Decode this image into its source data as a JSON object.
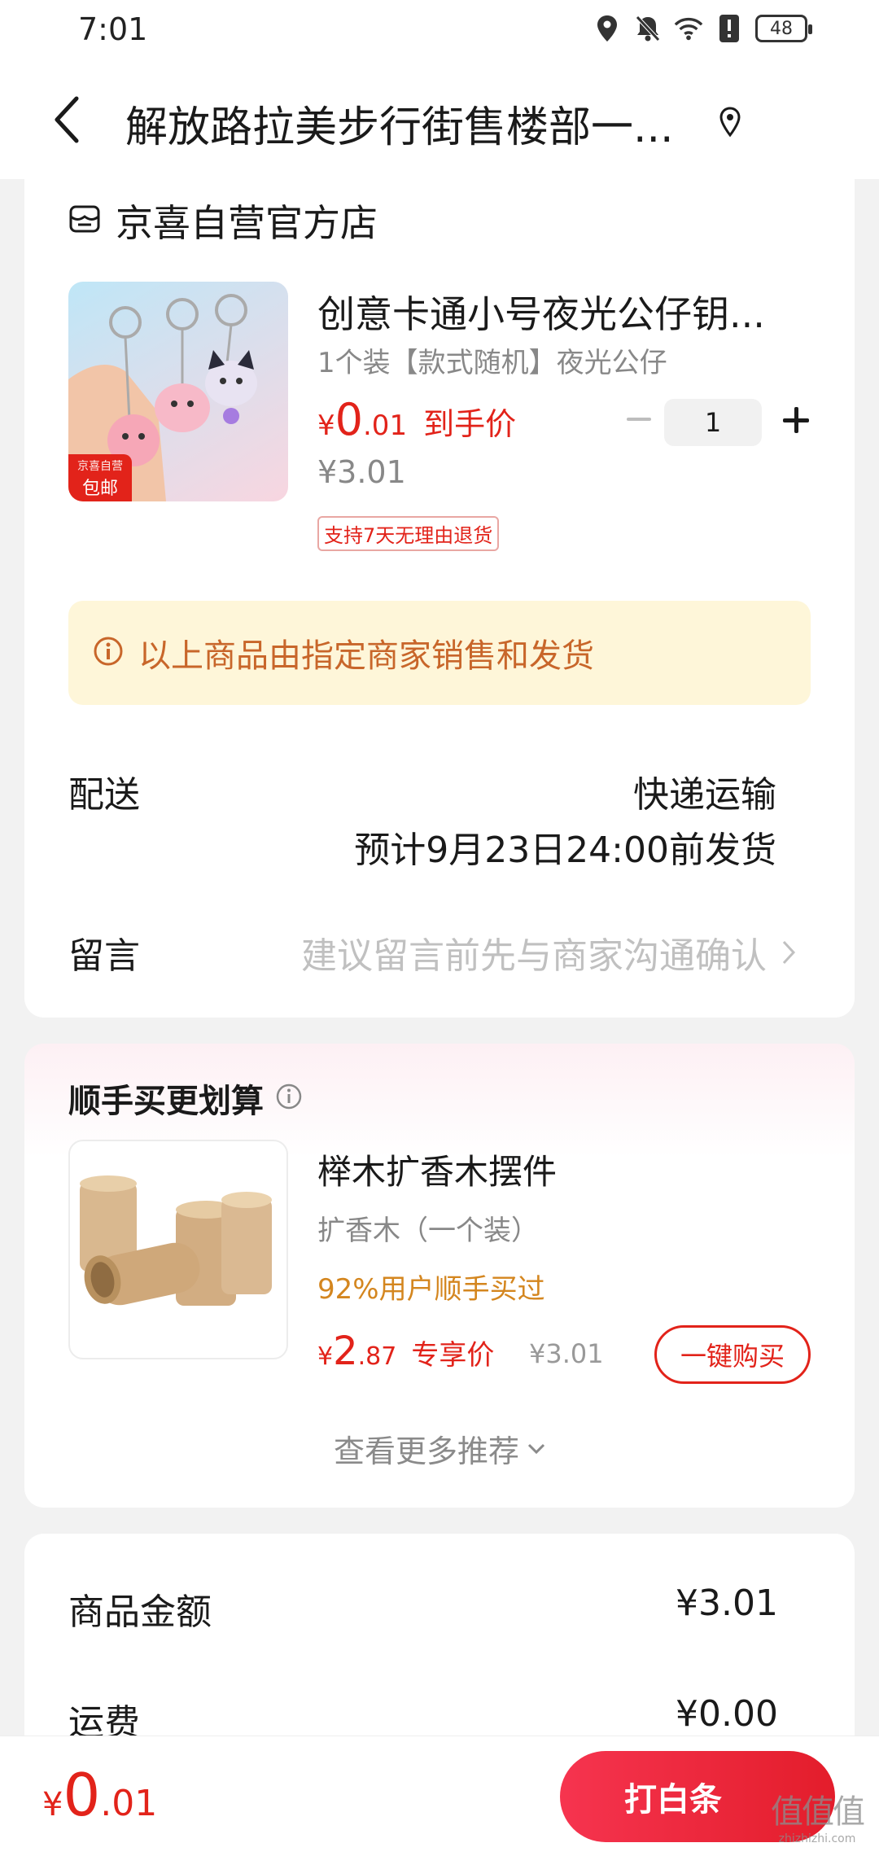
{
  "status": {
    "time": "7:01",
    "battery": "48"
  },
  "header": {
    "title": "解放路拉美步行街售楼部一..."
  },
  "store": {
    "name": "京喜自营官方店"
  },
  "product": {
    "title": "创意卡通小号夜光公仔钥...",
    "spec": "1个装【款式随机】夜光公仔",
    "price_symbol": "¥",
    "price_int": "0",
    "price_dec": ".01",
    "price_note": "到手价",
    "original_price": "¥3.01",
    "badge_line1": "京喜自营",
    "badge_line2": "包邮",
    "return_tag": "支持7天无理由退货",
    "quantity": "1"
  },
  "notice": {
    "text": "以上商品由指定商家销售和发货"
  },
  "delivery": {
    "label": "配送",
    "method": "快递运输",
    "eta": "预计9月23日24:00前发货"
  },
  "message": {
    "label": "留言",
    "placeholder": "建议留言前先与商家沟通确认"
  },
  "recommend": {
    "title": "顺手买更划算",
    "item": {
      "name": "榉木扩香木摆件",
      "spec": "扩香木（一个装）",
      "stat": "92%用户顺手买过",
      "price_symbol": "¥",
      "price_int": "2",
      "price_dec": ".87",
      "price_note": "专享价",
      "original_price": "¥3.01",
      "buy_label": "一键购买"
    },
    "more_label": "查看更多推荐"
  },
  "summary": {
    "goods_label": "商品金额",
    "goods_value": "¥3.01",
    "shipping_label": "运费",
    "shipping_value": "¥0.00"
  },
  "footer": {
    "total_symbol": "¥",
    "total_int": "0",
    "total_dec": ".01",
    "pay_label": "打白条",
    "watermark": "值值值",
    "watermark_sub": "zhizhizhi.com"
  },
  "colors": {
    "accent_red": "#e2231a",
    "notice_bg": "#fef6d9",
    "notice_text": "#c8662a",
    "stat_orange": "#d4861f"
  },
  "icons": [
    "location-icon",
    "mute-icon",
    "wifi-icon",
    "alert-icon",
    "battery-icon",
    "back-icon",
    "pin-icon",
    "store-icon",
    "info-icon",
    "chevron-right-icon",
    "chevron-down-icon"
  ]
}
